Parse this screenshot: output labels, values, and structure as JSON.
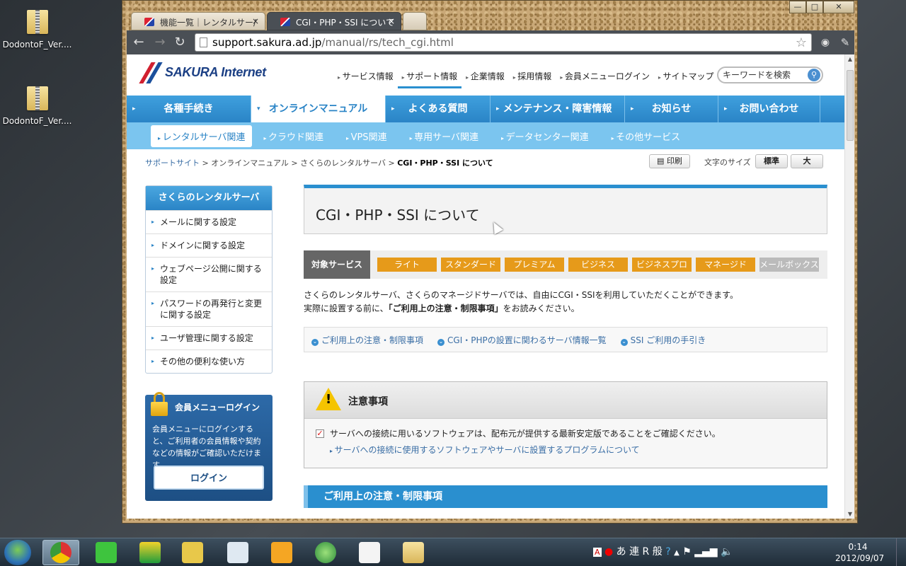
{
  "desktop": {
    "icons": [
      {
        "label": "DodontoF_Ver...."
      },
      {
        "label": "DodontoF_Ver...."
      }
    ]
  },
  "browser": {
    "tabs": [
      {
        "title": "機能一覧｜レンタルサー/",
        "active": false
      },
      {
        "title": "CGI・PHP・SSI について",
        "active": true
      }
    ],
    "address": {
      "domain": "support.sakura.ad.jp",
      "path": "/manual/rs/tech_cgi.html"
    },
    "window_buttons": [
      "—",
      "□",
      "✕"
    ]
  },
  "site": {
    "logo": "SAKURA Internet",
    "global_nav": [
      "サービス情報",
      "サポート情報",
      "企業情報",
      "採用情報",
      "会員メニューログイン",
      "サイトマップ"
    ],
    "search_placeholder": "キーワードを検索",
    "main_nav": [
      "各種手続き",
      "オンラインマニュアル",
      "よくある質問",
      "メンテナンス・障害情報",
      "お知らせ",
      "お問い合わせ"
    ],
    "sub_nav": [
      "レンタルサーバ関連",
      "クラウド関連",
      "VPS関連",
      "専用サーバ関連",
      "データセンター関連",
      "その他サービス"
    ],
    "breadcrumb": [
      "サポートサイト",
      "オンラインマニュアル",
      "さくらのレンタルサーバ",
      "CGI・PHP・SSI について"
    ],
    "print_label": "印刷",
    "fontsize_label": "文字のサイズ",
    "fontsize_options": [
      "標準",
      "大"
    ]
  },
  "sidebar": {
    "title": "さくらのレンタルサーバ",
    "items": [
      "メールに関する設定",
      "ドメインに関する設定",
      "ウェブページ公開に関する設定",
      "パスワードの再発行と変更に関する設定",
      "ユーザ管理に関する設定",
      "その他の便利な使い方"
    ]
  },
  "login": {
    "title": "会員メニューログイン",
    "description": "会員メニューにログインすると、ご利用者の会員情報や契約などの情報がご確認いただけます。",
    "button": "ログイン"
  },
  "content": {
    "title": "CGI・PHP・SSI について",
    "services_label": "対象サービス",
    "services": [
      {
        "name": "ライト",
        "enabled": true
      },
      {
        "name": "スタンダード",
        "enabled": true
      },
      {
        "name": "プレミアム",
        "enabled": true
      },
      {
        "name": "ビジネス",
        "enabled": true
      },
      {
        "name": "ビジネスプロ",
        "enabled": true
      },
      {
        "name": "マネージド",
        "enabled": true
      },
      {
        "name": "メールボックス",
        "enabled": false
      }
    ],
    "intro_line1": "さくらのレンタルサーバ、さくらのマネージドサーバでは、自由にCGI・SSIを利用していただくことができます。",
    "intro_line2_pre": "実際に設置する前に、",
    "intro_line2_bold": "「ご利用上の注意・制限事項」",
    "intro_line2_post": "をお読みください。",
    "anchors": [
      "ご利用上の注意・制限事項",
      "CGI・PHPの設置に関わるサーバ情報一覧",
      "SSI ご利用の手引き"
    ],
    "notice": {
      "title": "注意事項",
      "line": "サーバへの接続に用いるソフトウェアは、配布元が提供する最新安定版であることをご確認ください。",
      "link": "サーバへの接続に使用するソフトウェアやサーバに設置するプログラムについて"
    },
    "section_heading": "ご利用上の注意・制限事項"
  },
  "taskbar": {
    "tray_text": "あ 連 R 般",
    "time": "0:14",
    "date": "2012/09/07"
  }
}
